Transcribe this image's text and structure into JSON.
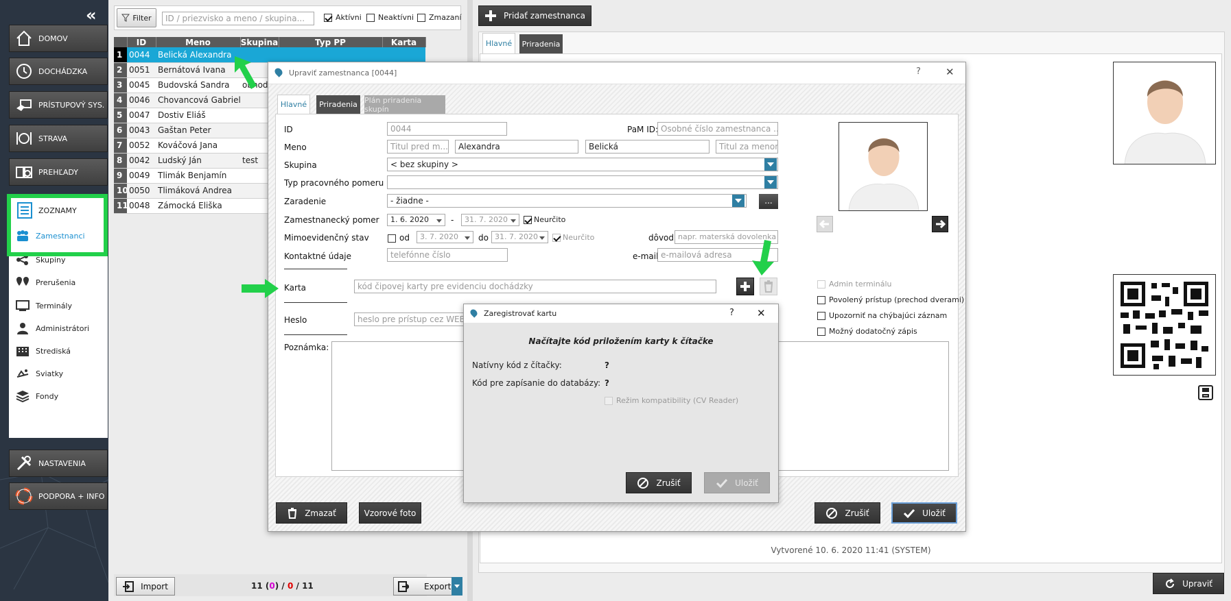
{
  "nav": {
    "collapse": "«",
    "items": [
      {
        "label": "DOMOV",
        "icon": "home-icon"
      },
      {
        "label": "DOCHÁDZKA",
        "icon": "clock-icon"
      },
      {
        "label": "PRÍSTUPOVÝ SYS.",
        "icon": "access-card-icon"
      },
      {
        "label": "STRAVA",
        "icon": "plate-icon"
      },
      {
        "label": "PREHĽADY",
        "icon": "reports-icon"
      }
    ],
    "zoznamy": "ZOZNAMY",
    "sub": [
      {
        "label": "Zamestnanci",
        "icon": "people-icon"
      },
      {
        "label": "Skupiny",
        "icon": "groups-icon"
      },
      {
        "label": "Prerušenia",
        "icon": "pins-icon"
      },
      {
        "label": "Terminály",
        "icon": "terminal-icon"
      },
      {
        "label": "Administrátori",
        "icon": "admin-icon"
      },
      {
        "label": "Strediská",
        "icon": "building-icon"
      },
      {
        "label": "Sviatky",
        "icon": "holiday-icon"
      },
      {
        "label": "Fondy",
        "icon": "layers-icon"
      }
    ],
    "settings": "NASTAVENIA",
    "support": "PODPORA + INFO"
  },
  "list": {
    "filter_label": "Filter",
    "search_placeholder": "ID / priezvisko a meno / skupina...",
    "active": "Aktívni",
    "inactive": "Neaktívni",
    "deleted": "Zmazaní",
    "columns": [
      "ID",
      "Meno",
      "Skupina",
      "Typ PP",
      "Karta"
    ],
    "rows": [
      {
        "n": "1",
        "id": "0044",
        "name": "Belická Alexandra",
        "group": ""
      },
      {
        "n": "2",
        "id": "0051",
        "name": "Bernátová Ivana",
        "group": ""
      },
      {
        "n": "3",
        "id": "0045",
        "name": "Budovská Sandra",
        "group": "obhod"
      },
      {
        "n": "4",
        "id": "0046",
        "name": "Chovancová Gabriela",
        "group": ""
      },
      {
        "n": "5",
        "id": "0047",
        "name": "Dostiv Eliáš",
        "group": ""
      },
      {
        "n": "6",
        "id": "0043",
        "name": "Gaštan Peter",
        "group": ""
      },
      {
        "n": "7",
        "id": "0052",
        "name": "Kováčová Jana",
        "group": ""
      },
      {
        "n": "8",
        "id": "0042",
        "name": "Ludský Ján",
        "group": "test"
      },
      {
        "n": "9",
        "id": "0049",
        "name": "Tlimák Benjamín",
        "group": ""
      },
      {
        "n": "10",
        "id": "0050",
        "name": "Tlimáková Andrea",
        "group": ""
      },
      {
        "n": "11",
        "id": "0048",
        "name": "Zámocká Eliška",
        "group": ""
      }
    ],
    "import": "Import",
    "count_a": "11 (",
    "count_b": "0",
    "count_c": ") / ",
    "count_d": "0",
    "count_e": " / 11",
    "export": "Export"
  },
  "right": {
    "add_employee": "Pridať zamestnanca",
    "tab_main": "Hlavné",
    "tab_assign": "Priradenia",
    "created": "Vytvorené 10. 6. 2020 11:41 (SYSTEM)",
    "edit": "Upraviť"
  },
  "edit": {
    "title": "Upraviť zamestnanca [0044]",
    "help": "?",
    "close": "✕",
    "tabs": [
      "Hlavné",
      "Priradenia",
      "Plán priradenia skupín"
    ],
    "id_label": "ID",
    "id_value": "0044",
    "pam_label": "PaM ID:",
    "pam_placeholder": "Osobné číslo zamestnanca ...",
    "name_label": "Meno",
    "title_before_ph": "Titul pred m...",
    "first_name": "Alexandra",
    "last_name": "Belická",
    "title_after_ph": "Titul za menom",
    "group_label": "Skupina",
    "group_value": "< bez skupiny >",
    "type_label": "Typ pracovného pomeru",
    "type_value": "",
    "assign_label": "Zaradenie",
    "assign_value": "- žiadne -",
    "dots": "...",
    "employment_label": "Zamestnanecký pomer",
    "emp_from": "1. 6. 2020",
    "dash": "-",
    "emp_to": "31. 7. 2020",
    "indef": "Neurčito",
    "offrec_label": "Mimoevidenčný stav",
    "od": "od",
    "off_from": "3. 7. 2020",
    "do": "do",
    "off_to": "31. 7. 2020",
    "off_indef": "Neurčito",
    "reason_label": "dôvod",
    "reason_ph": "napr. materská dovolenka",
    "contact_label": "Kontaktné údaje",
    "phone_ph": "telefónne číslo",
    "email_label": "e-mail",
    "email_ph": "e-mailová adresa",
    "card_label": "Karta",
    "card_ph": "kód čipovej karty pre evidenciu dochádzky",
    "pwd_label": "Heslo",
    "pwd_ph": "heslo pre prístup cez WEB ro",
    "note_label": "Poznámka:",
    "admin_term": "Admin terminálu",
    "allowed_access": "Povolený prístup (prechod dverami)",
    "warn_missing": "Upozorniť na chýbajúci záznam",
    "extra_write": "Možný dodatočný zápis",
    "delete": "Zmazať",
    "sample_photo": "Vzorové foto",
    "cancel": "Zrušiť",
    "save": "Uložiť"
  },
  "card": {
    "title": "Zaregistrovať kartu",
    "help": "?",
    "close": "✕",
    "instruction": "Načítajte kód priložením karty k čítačke",
    "native_label": "Natívny kód z čítačky:",
    "native_value": "?",
    "db_label": "Kód pre zapísanie do databázy:",
    "db_value": "?",
    "compat": "Režim kompatibility (CV Reader)",
    "cancel": "Zrušiť",
    "save": "Uložiť"
  },
  "colors": {
    "highlight_green": "#22d04a",
    "selected_row": "#1aa7d6",
    "combo_blue": "#2f7fa3"
  }
}
